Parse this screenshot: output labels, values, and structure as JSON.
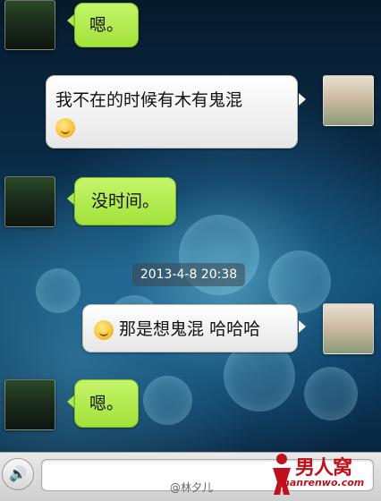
{
  "messages": [
    {
      "side": "left",
      "text": "嗯。"
    },
    {
      "side": "right",
      "text": "我不在的时候有木有鬼混"
    },
    {
      "side": "left",
      "text": "没时间。"
    },
    {
      "side": "right",
      "text": "那是想鬼混 哈哈哈"
    },
    {
      "side": "left",
      "text": "嗯。"
    }
  ],
  "timestamp": "2013-4-8 20:38",
  "watermark": {
    "logo_text": "男人窝",
    "logo_url": "nanrenwo.com",
    "weibo_credit": "@林夕儿"
  },
  "input": {
    "placeholder": ""
  },
  "colors": {
    "green_bubble": "#a2e23a",
    "white_bubble": "#ffffff",
    "logo_red": "#c0101c"
  }
}
